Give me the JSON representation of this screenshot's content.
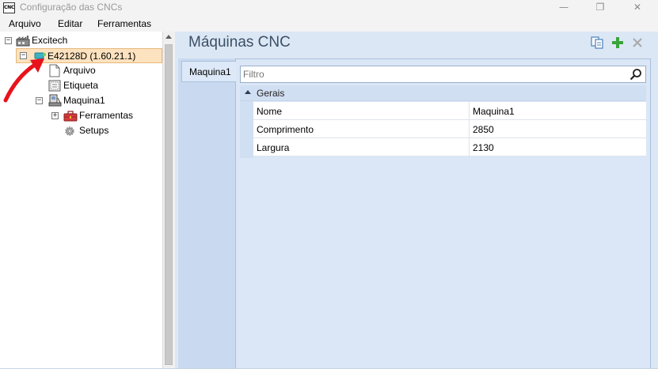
{
  "window": {
    "title": "Configuração das CNCs",
    "app_icon_text": "CNC",
    "controls": {
      "minimize": "—",
      "maximize": "❐",
      "close": "✕"
    }
  },
  "menu": [
    "Arquivo",
    "Editar",
    "Ferramentas"
  ],
  "tree": {
    "root": {
      "label": "Excitech",
      "expanded": true
    },
    "device": {
      "label": "E42128D (1.60.21.1)",
      "selected": true
    },
    "children": {
      "arquivo": "Arquivo",
      "etiqueta": "Etiqueta",
      "maquina": "Maquina1",
      "ferramentas": "Ferramentas",
      "setups": "Setups"
    },
    "expander_collapsed": "+",
    "expander_expanded": "−"
  },
  "main": {
    "title": "Máquinas CNC",
    "toolbar_icons": [
      "copy-icon",
      "add-icon",
      "delete-icon"
    ],
    "tabs": [
      {
        "label": "Maquina1",
        "active": true
      }
    ],
    "filter_placeholder": "Filtro",
    "property_grid": {
      "category": "Gerais",
      "rows": [
        {
          "name": "Nome",
          "value": "Maquina1"
        },
        {
          "name": "Comprimento",
          "value": "2850"
        },
        {
          "name": "Largura",
          "value": "2130"
        }
      ]
    }
  },
  "colors": {
    "selection_bg": "#fde2bf",
    "panel_bg": "#dce7f5",
    "annotation_arrow": "#e8121b",
    "add_icon": "#3aa33a"
  }
}
